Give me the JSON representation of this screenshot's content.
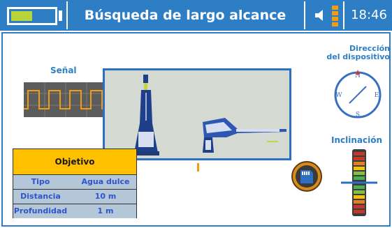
{
  "header": {
    "title": "Búsqueda de largo alcance",
    "time": "18:46",
    "battery_level": 0.5,
    "battery_color": "#b7d43a",
    "bar_color": "#2e7ec5",
    "speaker_icon": "speaker-icon",
    "volume_level": 0.75
  },
  "signal": {
    "label": "Señal"
  },
  "direction": {
    "label_line1": "Dirección",
    "label_line2": "del dispositivo",
    "compass_n": "N",
    "compass_e": "E",
    "compass_s": "S",
    "compass_w": "W"
  },
  "inclination": {
    "label": "Inclinación"
  },
  "target": {
    "header": "Objetivo",
    "rows": [
      {
        "key": "Tipo",
        "value": "Agua dulce"
      },
      {
        "key": "Distancia",
        "value": "10  m"
      },
      {
        "key": "Profundidad",
        "value": "1 m"
      }
    ]
  },
  "sd_card": {
    "icon": "sd-card-icon",
    "color": "#d98a1b"
  },
  "accent": "#f39c12"
}
